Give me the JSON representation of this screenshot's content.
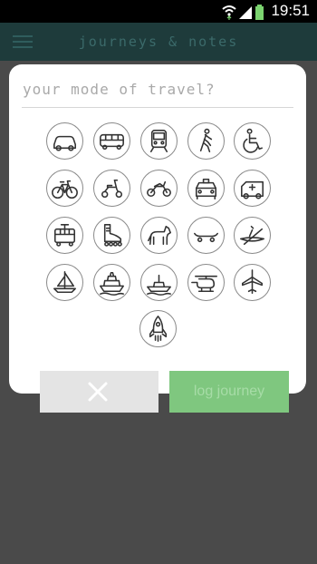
{
  "status": {
    "time": "19:51"
  },
  "app": {
    "title": "journeys & notes"
  },
  "dialog": {
    "prompt": "your mode of travel?",
    "modes": [
      {
        "name": "car",
        "icon": "car-icon"
      },
      {
        "name": "bus",
        "icon": "bus-icon"
      },
      {
        "name": "train",
        "icon": "train-icon"
      },
      {
        "name": "walk",
        "icon": "walking-icon"
      },
      {
        "name": "wheelchair",
        "icon": "wheelchair-icon"
      },
      {
        "name": "bicycle",
        "icon": "bicycle-icon"
      },
      {
        "name": "scooter",
        "icon": "scooter-icon"
      },
      {
        "name": "motorcycle",
        "icon": "motorcycle-icon"
      },
      {
        "name": "taxi",
        "icon": "taxi-icon"
      },
      {
        "name": "ambulance",
        "icon": "ambulance-icon"
      },
      {
        "name": "tram",
        "icon": "tram-icon"
      },
      {
        "name": "rollerskate",
        "icon": "rollerskate-icon"
      },
      {
        "name": "horse",
        "icon": "horse-icon"
      },
      {
        "name": "skateboard",
        "icon": "skateboard-icon"
      },
      {
        "name": "kayak",
        "icon": "kayak-icon"
      },
      {
        "name": "sailboat",
        "icon": "sailboat-icon"
      },
      {
        "name": "ferry",
        "icon": "ferry-icon"
      },
      {
        "name": "boat",
        "icon": "boat-icon"
      },
      {
        "name": "helicopter",
        "icon": "helicopter-icon"
      },
      {
        "name": "airplane",
        "icon": "airplane-icon"
      },
      {
        "name": "rocket",
        "icon": "rocket-icon"
      }
    ]
  },
  "buttons": {
    "cancel_icon": "close-icon",
    "log_label": "log journey"
  },
  "colors": {
    "appbar": "#1e3b3b",
    "accent": "#7fc77f",
    "backdrop": "#4a4a4a"
  }
}
